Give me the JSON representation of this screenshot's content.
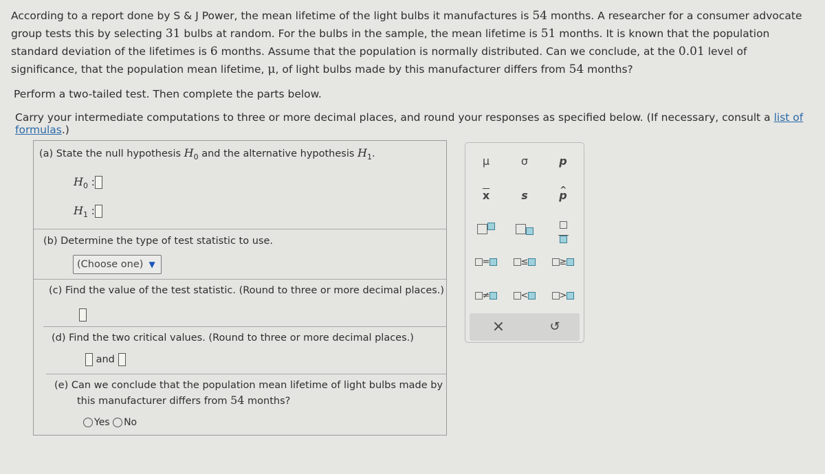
{
  "problem": {
    "p1_a": "According to a report done by S & J Power, the mean lifetime of the light bulbs it manufactures is ",
    "n_mean_claim": "54",
    "p1_b": " months. A researcher for a consumer advocate group tests this by selecting ",
    "n_sample": "31",
    "p1_c": " bulbs at random. For the bulbs in the sample, the mean lifetime is ",
    "n_sample_mean": "51",
    "p1_d": " months. It is known that the population standard deviation of the lifetimes is ",
    "n_sd": "6",
    "p1_e": " months. Assume that the population is normally distributed. Can we conclude, at the ",
    "n_alpha": "0.01",
    "p1_f": " level of significance, that the population mean lifetime, ",
    "mu": "μ",
    "p1_g": ", of light bulbs made by this manufacturer differs from ",
    "n_mean_claim2": "54",
    "p1_h": " months?",
    "instruction1": "Perform a two-tailed test. Then complete the parts below.",
    "instruction2": "Carry your intermediate computations to three or more decimal places, and round your responses as specified below. (If necessary, consult a ",
    "formulas_link": "list of formulas",
    "instruction2_end": ".)"
  },
  "parts": {
    "a": {
      "q1": "(a) State the null hypothesis ",
      "h0": "H",
      "h0_sub": "0",
      "q2": " and the alternative hypothesis ",
      "h1": "H",
      "h1_sub": "1",
      "q3": ".",
      "colon": ":"
    },
    "b": {
      "q": "(b) Determine the type of test statistic to use.",
      "select_value": "(Choose one)"
    },
    "c": {
      "q": "(c) Find the value of the test statistic. (Round to three or more decimal places.)"
    },
    "d": {
      "q": "(d) Find the two critical values. (Round to three or more decimal places.)",
      "and": "and"
    },
    "e": {
      "q1": "(e) Can we conclude that the population mean lifetime of light bulbs made by",
      "q2": "this manufacturer differs from ",
      "n": "54",
      "q3": " months?",
      "yes": "Yes",
      "no": "No"
    }
  },
  "palette": {
    "mu": "μ",
    "sigma": "σ",
    "p": "p",
    "xbar": "x",
    "s": "s",
    "phat": "p",
    "eq": "=",
    "le": "≤",
    "ge": "≥",
    "ne": "≠",
    "lt": "<",
    "gt": ">",
    "clear": "×",
    "undo": "↺"
  },
  "colors": {
    "link": "#2a6aa8",
    "dropdown_arrow": "#1a56b8",
    "palette_box": "#9fd1dc"
  }
}
